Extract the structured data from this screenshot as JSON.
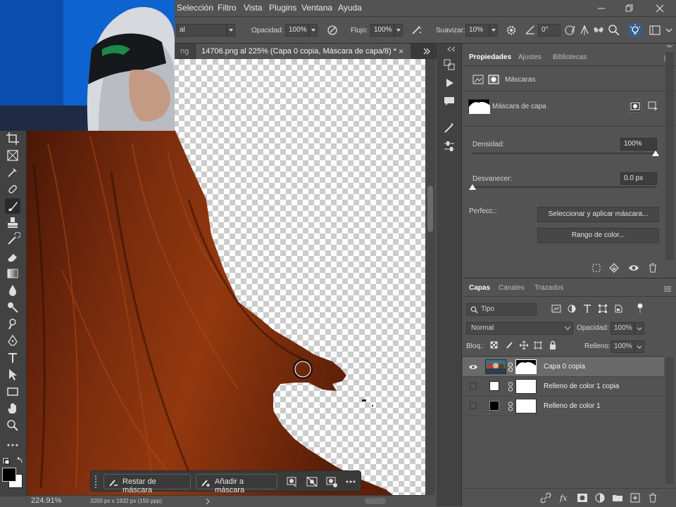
{
  "menubar": {
    "items": [
      "Selección",
      "Filtro",
      "Vista",
      "Plugins",
      "Ventana",
      "Ayuda"
    ]
  },
  "options": {
    "mode_value": "al",
    "opacity_label": "Opacidad:",
    "opacity_value": "100%",
    "flow_label": "Flujo:",
    "flow_value": "100%",
    "smoothing_label": "Suavizar:",
    "smoothing_value": "10%",
    "angle_value": "0°"
  },
  "tabs": {
    "prev_tab_fragment": "ng",
    "active_tab": "14706.png al 225% (Capa 0 copia, Máscara de capa/8) *",
    "close_glyph": "×"
  },
  "status": {
    "zoom": "224.91%",
    "doc_info": "3200 px x 1932 px (150 ppp)"
  },
  "context_bar": {
    "subtract_mask": "Restar de máscara",
    "add_mask": "Añadir a máscara"
  },
  "properties": {
    "tabs": [
      "Propiedades",
      "Ajustes",
      "Bibliotecas"
    ],
    "section_title": "Máscaras",
    "mask_type": "Máscara de capa",
    "density_label": "Densidad:",
    "density_value": "100%",
    "density_level": 1.0,
    "feather_label": "Desvanecer:",
    "feather_value": "0.0 px",
    "feather_level": 0.0,
    "refine_label": "Perfecc.:",
    "select_mask_button": "Seleccionar y aplicar máscara...",
    "color_range_button": "Rango de color..."
  },
  "layers": {
    "tabs": [
      "Capas",
      "Canales",
      "Trazados"
    ],
    "filter_value": "Tipo",
    "blend_mode": "Normal",
    "opacity_label": "Opacidad:",
    "opacity_value": "100%",
    "lock_label": "Bloq.:",
    "fill_label": "Relleno:",
    "fill_value": "100%",
    "rows": [
      {
        "name": "Capa 0 copia",
        "visible": true,
        "selected": true
      },
      {
        "name": "Relleno de color 1 copia",
        "visible": false,
        "selected": false
      },
      {
        "name": "Relleno de color 1",
        "visible": false,
        "selected": false
      }
    ]
  },
  "colors": {
    "ui_bg": "#535353",
    "panel_dark": "#424242",
    "hair": "#7a2c0b",
    "accent": "#2c8cf0"
  }
}
